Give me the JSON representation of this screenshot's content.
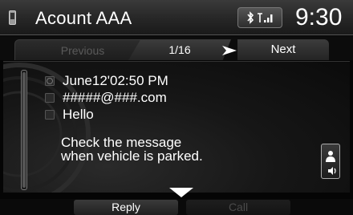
{
  "header": {
    "title": "Acount AAA",
    "clock": "9:30",
    "icons": [
      "phone-icon",
      "bluetooth-icon",
      "signal-strength-icon"
    ]
  },
  "tabs": {
    "previous_label": "Previous",
    "counter": "1/16",
    "next_label": "Next"
  },
  "message": {
    "datetime": "June12'02:50 PM",
    "sender": "#####@###.com",
    "subject": "Hello",
    "body_line1": "Check the message",
    "body_line2": "when vehicle is parked."
  },
  "footer": {
    "reply_label": "Reply",
    "call_label": "Call"
  }
}
